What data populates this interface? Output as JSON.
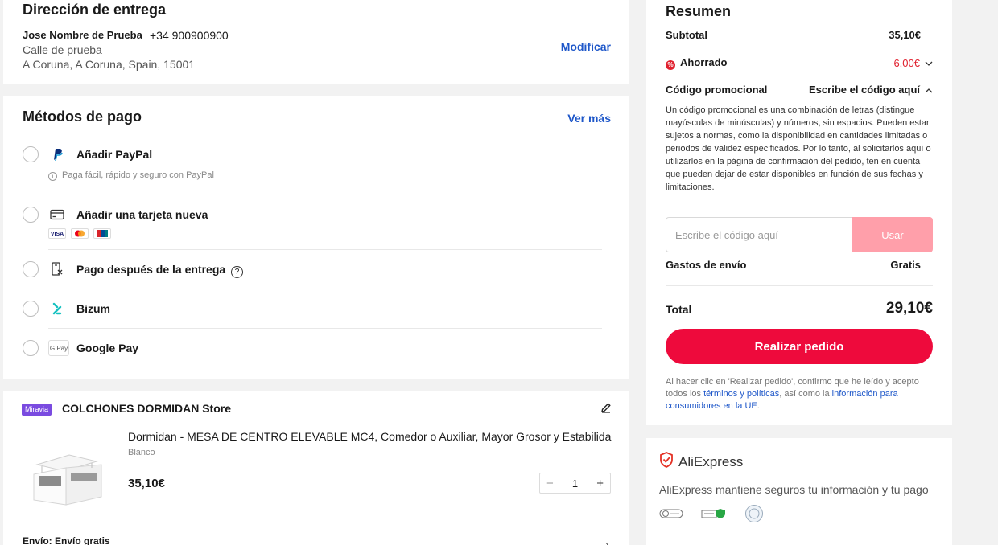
{
  "address": {
    "title": "Dirección de entrega",
    "name": "Jose Nombre de Prueba",
    "phone": "+34 900900900",
    "line1": "Calle de prueba",
    "line2": "A Coruna, A Coruna, Spain, 15001",
    "edit_label": "Modificar"
  },
  "payment": {
    "title": "Métodos de pago",
    "more_label": "Ver más",
    "methods": [
      {
        "label": "Añadir PayPal",
        "sub": "Paga fácil, rápido y seguro con PayPal",
        "icon": "paypal-icon"
      },
      {
        "label": "Añadir una tarjeta nueva",
        "icon": "credit-card-icon",
        "cards": [
          "VISA",
          "mastercard",
          "UnionPay"
        ]
      },
      {
        "label": "Pago después de la entrega",
        "icon": "cash-on-delivery-icon"
      },
      {
        "label": "Bizum",
        "icon": "bizum-icon"
      },
      {
        "label": "Google Pay",
        "icon": "google-pay-icon",
        "icon_text": "G Pay"
      }
    ]
  },
  "store": {
    "badge": "Miravia",
    "name": "COLCHONES DORMIDAN Store",
    "product_title": "Dormidan - MESA DE CENTRO ELEVABLE MC4, Comedor o Auxiliar, Mayor Grosor y Estabilidad",
    "product_color": "Blanco",
    "price": "35,10€",
    "qty": "1",
    "shipping": "Envío: Envío gratis"
  },
  "summary": {
    "title": "Resumen",
    "subtotal_label": "Subtotal",
    "subtotal_value": "35,10€",
    "saved_label": "Ahorrado",
    "saved_value": "-6,00€",
    "promo_label": "Código promocional",
    "promo_action": "Escribe el código aquí",
    "promo_text": "Un código promocional es una combinación de letras (distingue mayúsculas de minúsculas) y números, sin espacios. Pueden estar sujetos a normas, como la disponibilidad en cantidades limitadas o periodos de validez especificados. Por lo tanto, al solicitarlos aquí o utilizarlos en la página de confirmación del pedido, ten en cuenta que pueden dejar de estar disponibles en función de sus fechas y limitaciones.",
    "promo_placeholder": "Escribe el código aquí",
    "promo_button": "Usar",
    "shipping_label": "Gastos de envío",
    "shipping_value": "Gratis",
    "total_label": "Total",
    "total_value": "29,10€",
    "order_button": "Realizar pedido",
    "legal_1": "Al hacer clic en 'Realizar pedido', confirmo que he leído y acepto todos los ",
    "legal_link1": "términos y políticas",
    "legal_2": ", así como la ",
    "legal_link2": "información para consumidores en la UE",
    "legal_3": "."
  },
  "trust": {
    "brand": "AliExpress",
    "text": "AliExpress mantiene seguros tu información y tu pago"
  },
  "colors": {
    "accent": "#ee0a3c",
    "link": "#1e57c9",
    "disabled_button": "#ff9faa",
    "badge": "#7a4be0"
  }
}
